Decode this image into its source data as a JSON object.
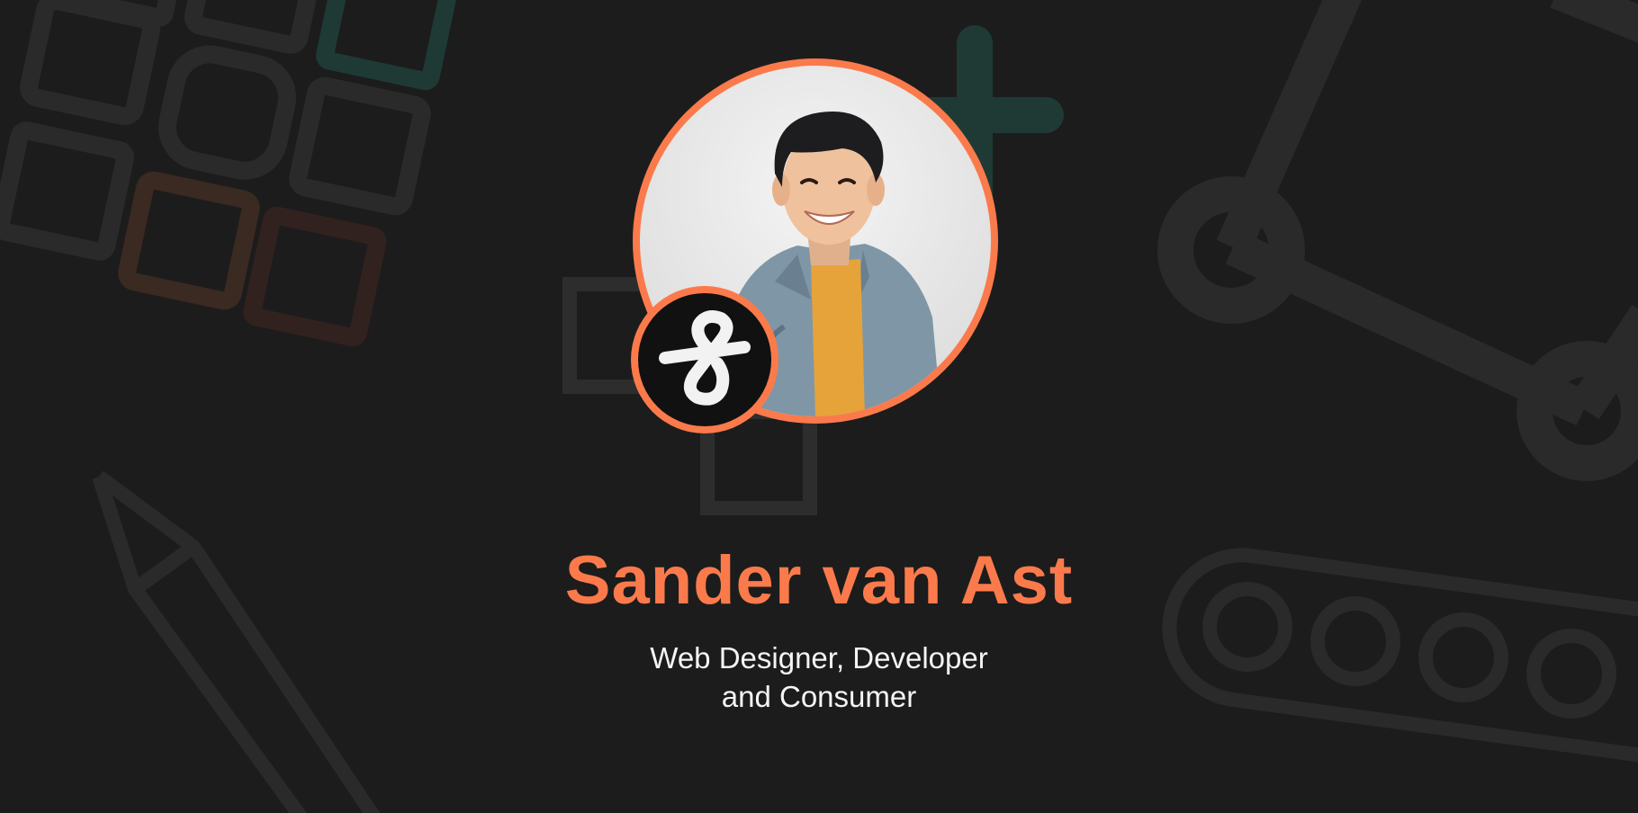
{
  "profile": {
    "name": "Sander van Ast",
    "tagline_line1": "Web Designer, Developer",
    "tagline_line2": "and Consumer"
  },
  "icons": {
    "avatar": "person-portrait-photo",
    "logo": "ampersand-logo-icon",
    "decor": [
      "grid-squares-icon",
      "plus-icon",
      "robot-arm-icon",
      "pencil-icon",
      "conveyor-belt-icon"
    ]
  },
  "colors": {
    "background": "#1c1c1c",
    "accent": "#fb7a4b",
    "text": "#f4f4f4",
    "decor_gray": "#2a2a2a",
    "decor_teal": "#1f3a35",
    "decor_brown": "#3a2a22"
  }
}
